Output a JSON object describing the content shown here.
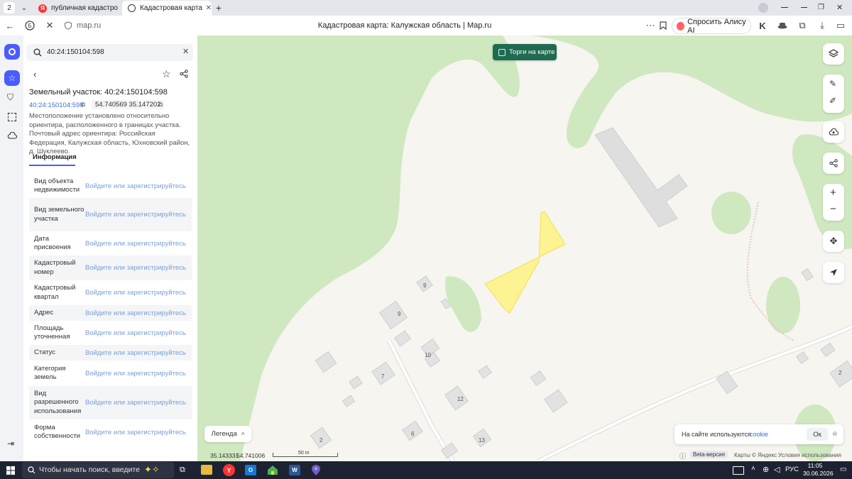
{
  "browser": {
    "tab_count": "2",
    "tabs": [
      {
        "title": "публичная кадастровая к"
      },
      {
        "title": "Кадастровая карта: Ка"
      }
    ],
    "new_tab": "+",
    "url": "map.ru",
    "page_title": "Кадастровая карта: Калужская область | Map.ru",
    "alice_label": "Спросить Алису AI"
  },
  "search": {
    "value": "40:24:150104:598"
  },
  "parcel": {
    "heading": "Земельный участок: 40:24:150104:598",
    "number": "40:24:150104:598",
    "coords": "54.740569 35.147202",
    "description": "Местоположение установлено относительно ориентира, расположенного в границах участка. Почтовый адрес ориентира: Российская Федерация, Калужская область, Юхновский район, д. Шуклеево.",
    "tab_info": "Информация",
    "rows": [
      {
        "key": "Вид объекта недвижимости",
        "value": "Войдите или зарегистрируйтесь"
      },
      {
        "key": "Вид земельного участка",
        "value": "Войдите или зарегистрируйтесь"
      },
      {
        "key": "Дата присвоения",
        "value": "Войдите или зарегистрируйтесь"
      },
      {
        "key": "Кадастровый номер",
        "value": "Войдите или зарегистрируйтесь"
      },
      {
        "key": "Кадастровый квартал",
        "value": "Войдите или зарегистрируйтесь"
      },
      {
        "key": "Адрес",
        "value": "Войдите или зарегистрируйтесь"
      },
      {
        "key": "Площадь уточненная",
        "value": "Войдите или зарегистрируйтесь"
      },
      {
        "key": "Статус",
        "value": "Войдите или зарегистрируйтесь"
      },
      {
        "key": "Категория земель",
        "value": "Войдите или зарегистрируйтесь"
      },
      {
        "key": "Вид разрешенного использования",
        "value": "Войдите или зарегистрируйтесь"
      },
      {
        "key": "Форма собственности",
        "value": "Войдите или зарегистрируйтесь"
      }
    ]
  },
  "map": {
    "toggle_label": "Торги на карте",
    "legend_label": "Легенда",
    "coord_lon": "35.143331",
    "coord_lat": "54.741006",
    "scale_label": "50 m",
    "beta_label": "Beta-версия",
    "maps_label": "Карты © Яндекс",
    "terms_label": "Условия использования",
    "cookie_text": "На сайте используются",
    "cookie_link": "cookie",
    "cookie_ok": "Ок",
    "house_numbers": [
      "9",
      "9",
      "10",
      "7",
      "12",
      "6",
      "2",
      "13",
      "2"
    ]
  },
  "taskbar": {
    "search_placeholder": "Чтобы начать поиск, введите",
    "lang": "РУС",
    "time": "11:05",
    "date": "30.06.2026"
  },
  "colors": {
    "accent": "#4a5cff",
    "link": "#3b6fd1",
    "forest": "#cfe8c0",
    "parcel": "#fff27a",
    "green_button": "#1e6b52"
  }
}
